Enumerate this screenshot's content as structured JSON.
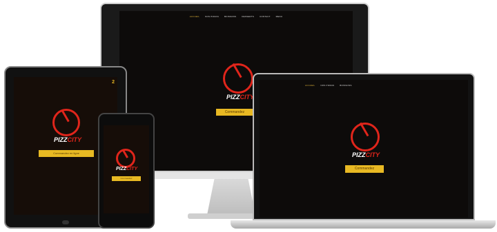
{
  "scene": {
    "devices": [
      "monitor",
      "tablet",
      "phone",
      "laptop"
    ]
  },
  "site": {
    "logo_main": "PIZZ",
    "logo_accent": "CITY",
    "nav": [
      "ACCUEIL",
      "NOS PIZZAS",
      "BOISSONS",
      "DESSERTS",
      "CONTACT",
      "MENU"
    ],
    "cta_label": "Commandez",
    "tablet_cta_label": "Commandez en ligne",
    "tablet_corner": "2"
  },
  "colors": {
    "accent_red": "#e0251b",
    "accent_gold": "#e8b923"
  }
}
